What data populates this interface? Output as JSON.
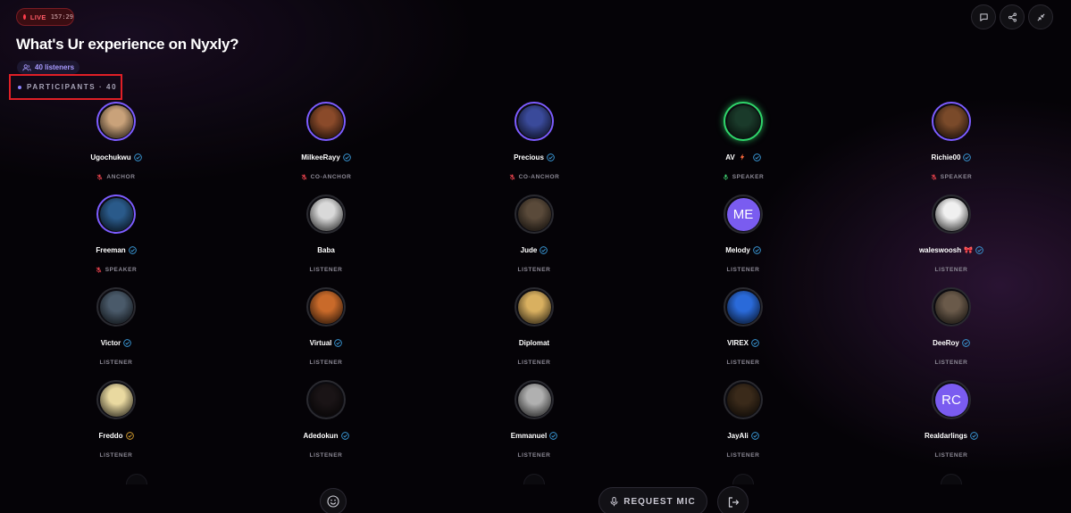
{
  "header": {
    "live_label": "LIVE",
    "live_time": "157:29",
    "title": "What's Ur experience on Nyxly?",
    "listeners": "40 listeners",
    "participants_label": "PARTICIPANTS · 40"
  },
  "actions": {
    "chat_icon": "chat-bubble-icon",
    "share_icon": "share-icon",
    "minimize_icon": "minimize-icon"
  },
  "participants": [
    {
      "name": "Ugochukwu",
      "role": "ANCHOR",
      "verified": true,
      "badge_color": "#3a9ad9",
      "ring": "host",
      "mic": "muted",
      "avatar_color": "#c9a27a"
    },
    {
      "name": "MilkeeRayy",
      "role": "CO-ANCHOR",
      "verified": true,
      "badge_color": "#3a9ad9",
      "ring": "host",
      "mic": "muted",
      "avatar_color": "#8a4a2a"
    },
    {
      "name": "Precious",
      "role": "CO-ANCHOR",
      "verified": true,
      "badge_color": "#3a9ad9",
      "ring": "host",
      "mic": "muted",
      "avatar_color": "#3a4a9a"
    },
    {
      "name": "AV",
      "role": "SPEAKER",
      "verified": true,
      "badge_color": "#3a9ad9",
      "ring": "active",
      "mic": "on",
      "bolt": true,
      "avatar_color": "#1a3a2a"
    },
    {
      "name": "Richie00",
      "role": "SPEAKER",
      "verified": true,
      "badge_color": "#3a9ad9",
      "ring": "host",
      "mic": "muted",
      "avatar_color": "#7a4a2a"
    },
    {
      "name": "Freeman",
      "role": "SPEAKER",
      "verified": true,
      "badge_color": "#3a9ad9",
      "ring": "host",
      "mic": "muted",
      "avatar_color": "#2a5a8a"
    },
    {
      "name": "Baba",
      "role": "LISTENER",
      "verified": false,
      "ring": "none",
      "avatar_color": "#d9d9d9"
    },
    {
      "name": "Jude",
      "role": "LISTENER",
      "verified": true,
      "badge_color": "#3a9ad9",
      "ring": "none",
      "avatar_color": "#5a4a3a"
    },
    {
      "name": "Melody",
      "role": "LISTENER",
      "verified": true,
      "badge_color": "#3a9ad9",
      "ring": "none",
      "initials": "ME"
    },
    {
      "name": "waleswoosh",
      "name_suffix": "🎀",
      "role": "LISTENER",
      "verified": true,
      "badge_color": "#3a9ad9",
      "ring": "none",
      "avatar_color": "#f0f0f0"
    },
    {
      "name": "Victor",
      "role": "LISTENER",
      "verified": true,
      "badge_color": "#3a9ad9",
      "ring": "none",
      "avatar_color": "#4a5a6a"
    },
    {
      "name": "Virtual",
      "role": "LISTENER",
      "verified": true,
      "badge_color": "#3a9ad9",
      "ring": "none",
      "avatar_color": "#c96a2a"
    },
    {
      "name": "Diplomat",
      "role": "LISTENER",
      "verified": false,
      "ring": "none",
      "avatar_color": "#d9b060"
    },
    {
      "name": "VIREX",
      "role": "LISTENER",
      "verified": true,
      "badge_color": "#3a9ad9",
      "ring": "none",
      "avatar_color": "#2a6ad9"
    },
    {
      "name": "DeeRoy",
      "role": "LISTENER",
      "verified": true,
      "badge_color": "#3a9ad9",
      "ring": "none",
      "avatar_color": "#6a5a4a"
    },
    {
      "name": "Freddo",
      "role": "LISTENER",
      "verified": true,
      "badge_color": "#d9a030",
      "ring": "none",
      "avatar_color": "#e9d9a0"
    },
    {
      "name": "Adedokun",
      "role": "LISTENER",
      "verified": true,
      "badge_color": "#3a9ad9",
      "ring": "none",
      "avatar_color": "#1a1416"
    },
    {
      "name": "Emmanuel",
      "role": "LISTENER",
      "verified": true,
      "badge_color": "#3a9ad9",
      "ring": "none",
      "avatar_color": "#b0b0b0"
    },
    {
      "name": "JayAli",
      "role": "LISTENER",
      "verified": true,
      "badge_color": "#3a9ad9",
      "ring": "none",
      "avatar_color": "#3a2a1a"
    },
    {
      "name": "Realdarlings",
      "role": "LISTENER",
      "verified": true,
      "badge_color": "#3a9ad9",
      "ring": "none",
      "initials": "RC"
    }
  ],
  "bottom": {
    "emoji_icon": "smiley-icon",
    "request_label": "REQUEST MIC",
    "leave_icon": "leave-icon"
  },
  "colors": {
    "accent": "#7c5cff",
    "live_red": "#ff3d4c",
    "speaking_green": "#2fd56a"
  }
}
